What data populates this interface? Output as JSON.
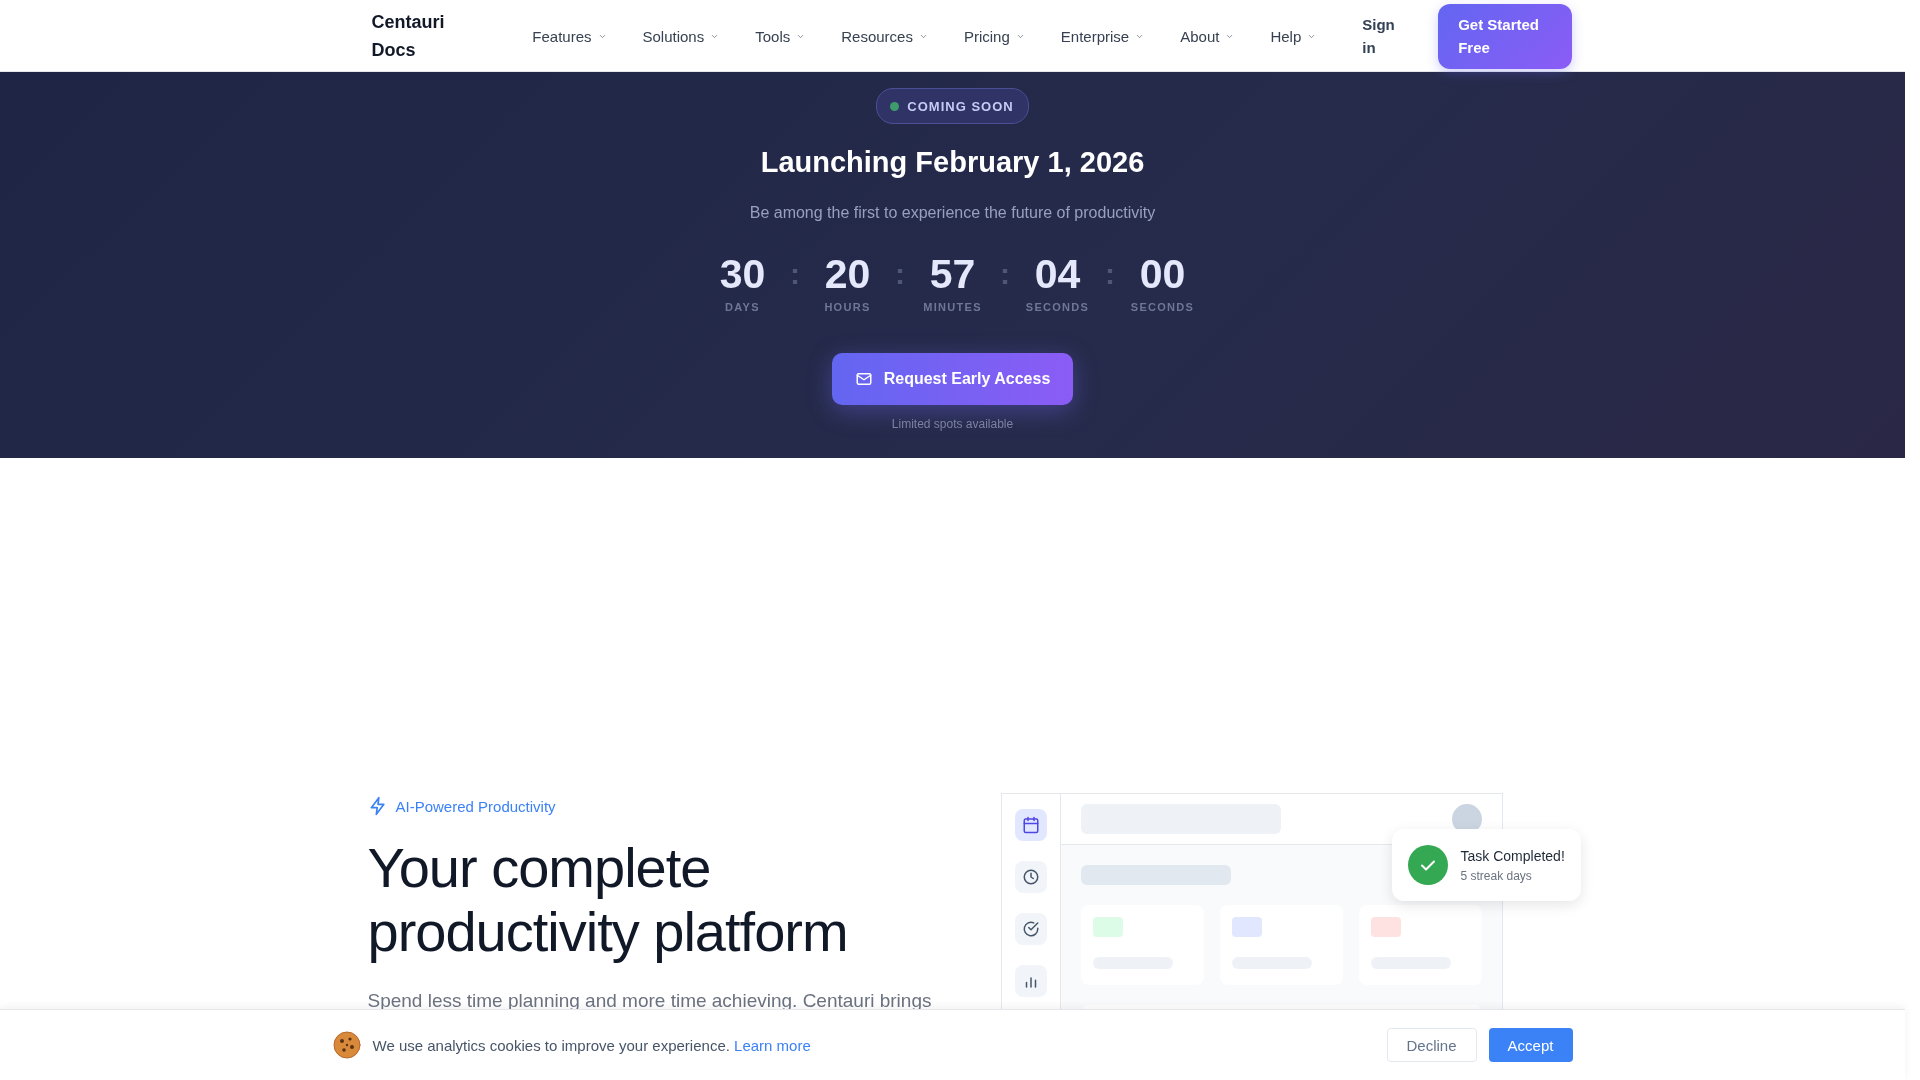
{
  "header": {
    "logo": "Centauri Docs",
    "nav": [
      {
        "label": "Features",
        "has_menu": true
      },
      {
        "label": "Solutions",
        "has_menu": true
      },
      {
        "label": "Tools",
        "has_menu": true
      },
      {
        "label": "Resources",
        "has_menu": true
      },
      {
        "label": "Pricing",
        "has_menu": true
      },
      {
        "label": "Enterprise",
        "has_menu": true
      },
      {
        "label": "About",
        "has_menu": true
      },
      {
        "label": "Help",
        "has_menu": true
      }
    ],
    "sign_in": "Sign in",
    "cta": "Get Started Free"
  },
  "launch": {
    "badge": "COMING SOON",
    "title": "Launching February 1, 2026",
    "subtitle": "Be among the first to experience the future of productivity",
    "separator": ":",
    "countdown": [
      {
        "value": "30",
        "unit": "DAYS"
      },
      {
        "value": "20",
        "unit": "HOURS"
      },
      {
        "value": "57",
        "unit": "MINUTES"
      },
      {
        "value": "04",
        "unit": "SECONDS"
      },
      {
        "value": "00",
        "unit": "SECONDS"
      }
    ],
    "button": "Request Early Access",
    "note": "Limited spots available"
  },
  "hero": {
    "tag": "AI-Powered Productivity",
    "title": "Your complete productivity platform",
    "text": "Spend less time planning and more time achieving. Centauri brings"
  },
  "mockup": {
    "sidebar": [
      {
        "kind": "calendar",
        "selected": true
      },
      {
        "kind": "clock",
        "selected": false
      },
      {
        "kind": "check",
        "selected": false
      },
      {
        "kind": "chart",
        "selected": false
      }
    ],
    "cards": [
      {
        "color": "#dcfce7"
      },
      {
        "color": "#e0e7ff"
      },
      {
        "color": "#fee2e2"
      }
    ],
    "toast": {
      "title": "Task Completed!",
      "text": "5 streak days"
    }
  },
  "cookie": {
    "text": "We use analytics cookies to improve your experience.",
    "link": "Learn more",
    "decline": "Decline",
    "accept": "Accept"
  }
}
